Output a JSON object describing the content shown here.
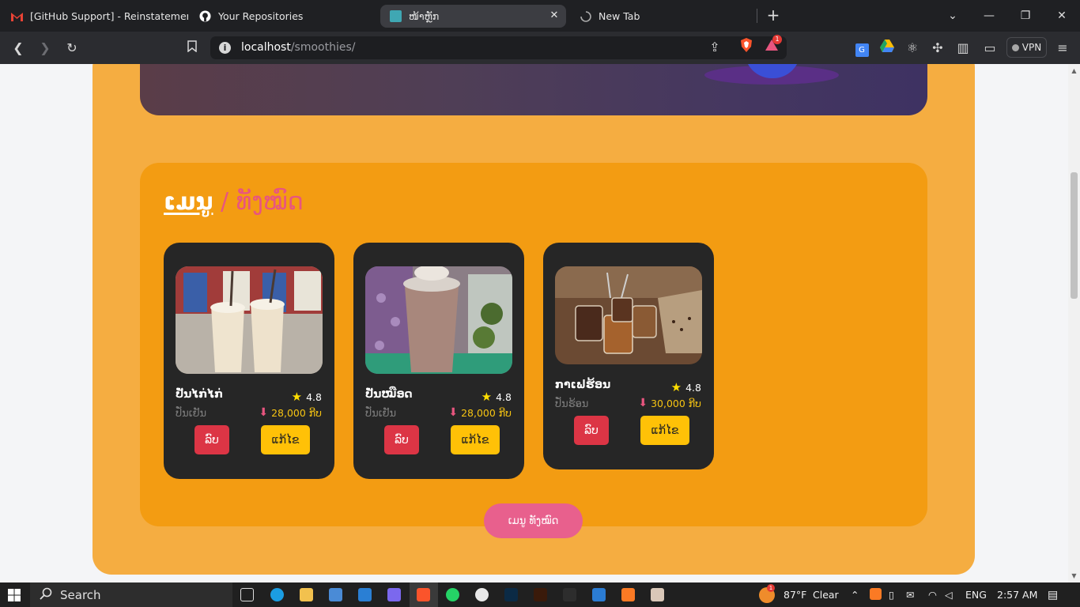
{
  "browser": {
    "tabs": [
      {
        "title": "[GitHub Support] - Reinstatement Re"
      },
      {
        "title": "Your Repositories"
      },
      {
        "title": "ໜ້າຫຼັກ"
      },
      {
        "title": "New Tab"
      }
    ],
    "url_host": "localhost",
    "url_path": "/smoothies/",
    "vpn_label": "VPN",
    "notification_count": "1"
  },
  "menu": {
    "title_main": "ເມນູ",
    "title_sep": " / ",
    "title_all": "ທັງໝົດ",
    "items": [
      {
        "name": "ປັ່ນໄກ່ໄກ່",
        "category": "ປັ່ນເຢັນ",
        "rating": "4.8",
        "price": "28,000 ກີບ",
        "delete_label": "ລົບ",
        "edit_label": "ແກ້ໄຂ"
      },
      {
        "name": "ປັ່ນໝືອດ",
        "category": "ປັ່ນເຢັນ",
        "rating": "4.8",
        "price": "28,000 ກີບ",
        "delete_label": "ລົບ",
        "edit_label": "ແກ້ໄຂ"
      },
      {
        "name": "ກາເຟຮ້ອນ",
        "category": "ປັ່ນຮ້ອນ",
        "rating": "4.8",
        "price": "30,000 ກີບ",
        "delete_label": "ລົບ",
        "edit_label": "ແກ້ໄຂ"
      }
    ],
    "all_button": "ເມນູ ທັງໝົດ"
  },
  "taskbar": {
    "search_label": "Search",
    "weather_temp": "87°F",
    "weather_text": "Clear",
    "language": "ENG",
    "time": "2:57 AM",
    "weather_badge": "1"
  },
  "colors": {
    "outer_bg": "#f5ad41",
    "panel_bg": "#f39c12",
    "card_bg": "#262626",
    "accent_pink": "#e8557f",
    "delete_red": "#dc3545",
    "edit_yellow": "#ffc107"
  }
}
